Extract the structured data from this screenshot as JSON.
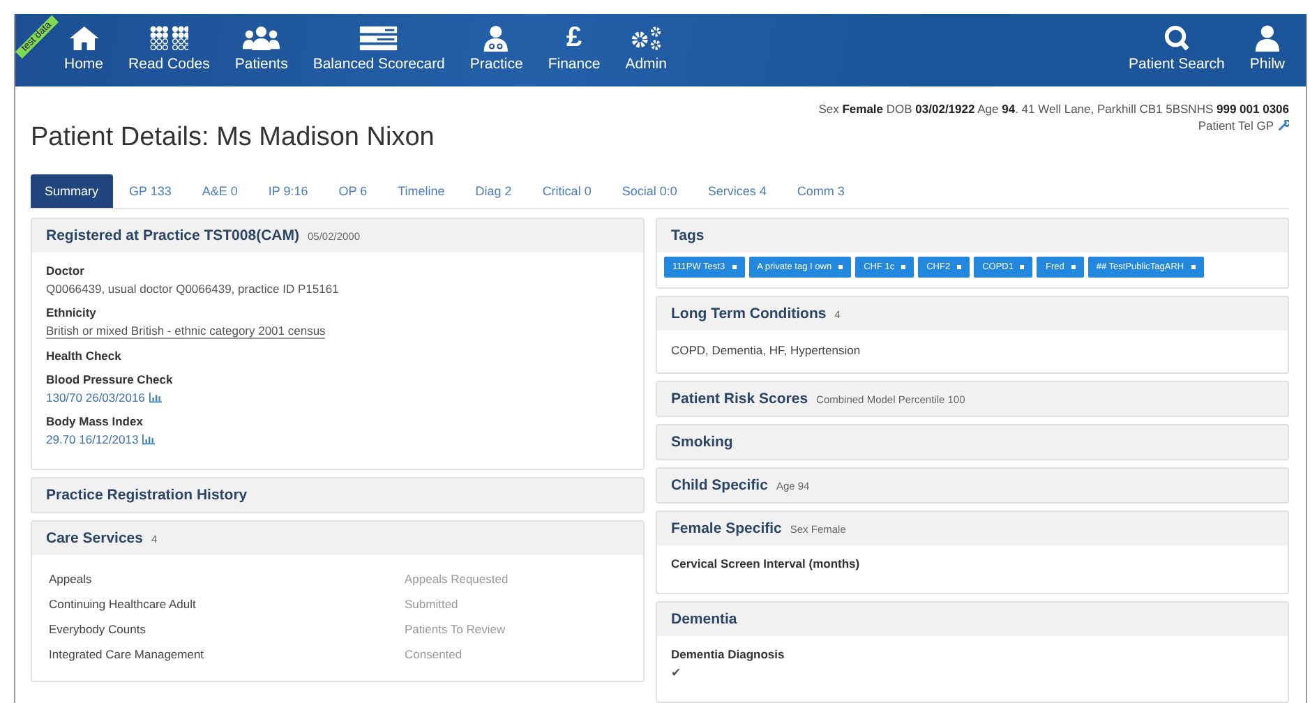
{
  "ribbon": "test data",
  "nav": [
    {
      "label": "Home"
    },
    {
      "label": "Read Codes"
    },
    {
      "label": "Patients"
    },
    {
      "label": "Balanced Scorecard"
    },
    {
      "label": "Practice"
    },
    {
      "label": "Finance",
      "glyph": "£"
    },
    {
      "label": "Admin"
    }
  ],
  "nav_right": [
    {
      "label": "Patient Search"
    },
    {
      "label": "Philw"
    }
  ],
  "patient_info": "Sex **Female** DOB **03/02/1922** Age **94**. 41 Well Lane, Parkhill CB1 5BSNHS **999 001 0306**",
  "patient_tel": "Patient Tel GP",
  "title": "Patient Details: Ms Madison Nixon",
  "tabs": [
    {
      "label": "Summary",
      "selected": true
    },
    {
      "label": "GP 133",
      "selected": false
    },
    {
      "label": "A&E 0",
      "selected": false
    },
    {
      "label": "IP 9:16",
      "selected": false
    },
    {
      "label": "OP 6",
      "selected": false
    },
    {
      "label": "Timeline",
      "selected": false
    },
    {
      "label": "Diag 2",
      "selected": false
    },
    {
      "label": "Critical 0",
      "selected": false
    },
    {
      "label": "Social 0:0",
      "selected": false
    },
    {
      "label": "Services 4",
      "selected": false
    },
    {
      "label": "Comm 3",
      "selected": false
    }
  ],
  "left_panels": [
    {
      "title": "Registered at Practice TST008(CAM)",
      "note": "05/02/2000",
      "fields": [
        {
          "label": "Doctor",
          "value": "Q0066439, usual doctor Q0066439, practice ID P15161",
          "kind": "plain"
        },
        {
          "label": "Ethnicity",
          "value": "British or mixed British - ethnic category 2001 census",
          "kind": "underlined"
        },
        {
          "label": "Health Check",
          "kind": "heading"
        },
        {
          "label": "Blood Pressure Check",
          "value": "130/70 26/03/2016",
          "kind": "trend"
        },
        {
          "label": "Body Mass Index",
          "value": "29.70 16/12/2013",
          "kind": "trend"
        }
      ]
    },
    {
      "title": "Practice Registration History"
    },
    {
      "title": "Care Services",
      "note": "4",
      "services": [
        {
          "name": "Appeals",
          "status": "Appeals Requested"
        },
        {
          "name": "Continuing Healthcare Adult",
          "status": "Submitted"
        },
        {
          "name": "Everybody Counts",
          "status": "Patients To Review"
        },
        {
          "name": "Integrated Care Management",
          "status": "Consented"
        }
      ]
    }
  ],
  "right_panels": [
    {
      "title": "Tags",
      "tags": [
        "111PW Test3",
        "A private tag I own",
        "CHF 1c",
        "CHF2",
        "COPD1",
        "Fred",
        "## TestPublicTagARH"
      ]
    },
    {
      "title": "Long Term Conditions",
      "note": "4",
      "text": "COPD, Dementia, HF, Hypertension"
    },
    {
      "title": "Patient Risk Scores",
      "note": "Combined Model Percentile 100"
    },
    {
      "title": "Smoking"
    },
    {
      "title": "Child Specific",
      "note": "Age 94"
    },
    {
      "title": "Female Specific",
      "note": "Sex Female",
      "fields": [
        {
          "label": "Cervical Screen Interval (months)",
          "kind": "heading"
        }
      ]
    },
    {
      "title": "Dementia",
      "fields": [
        {
          "label": "Dementia Diagnosis",
          "value": "✔",
          "kind": "plain"
        }
      ]
    }
  ]
}
